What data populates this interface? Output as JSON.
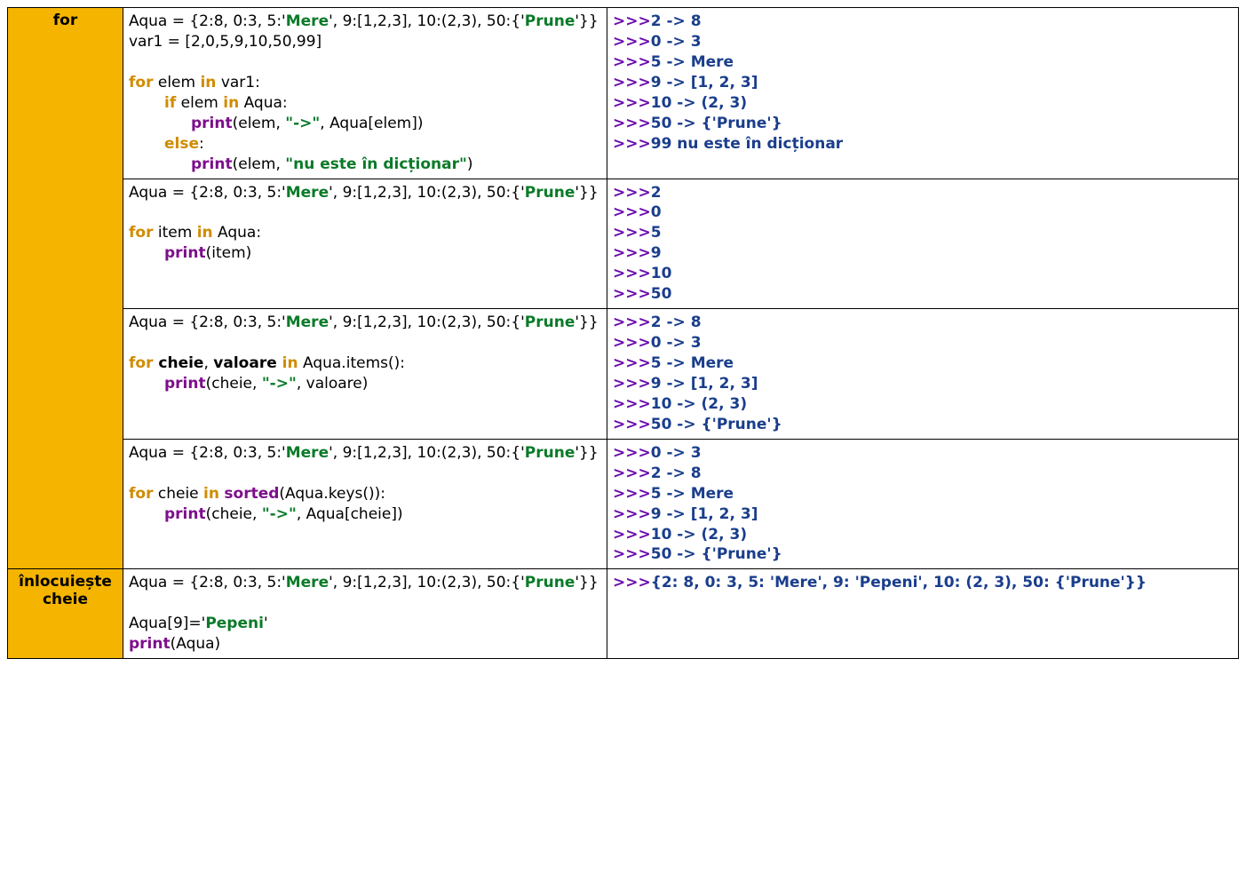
{
  "labels": {
    "for": "for",
    "replace": "înlocuiește cheie"
  },
  "common": {
    "aqua_prefix": "Aqua = {2:8, 0:3, 5:'",
    "aqua_mere": "Mere",
    "aqua_mid": "', 9:[1,2,3], 10:(2,3), 50:{'",
    "aqua_prune": "Prune",
    "aqua_suffix": "'}}"
  },
  "r1": {
    "var1": "var1 = [2,0,5,9,10,50,99]",
    "for": "for",
    "elem_in": " elem ",
    "in": "in",
    "var1b": " var1:",
    "if": "if",
    "cond": " elem ",
    "aqua": " Aqua:",
    "print": "print",
    "p1": "(elem, ",
    "arrow": "\"->\"",
    "p1b": ", Aqua[elem])",
    "else": "else",
    "p2": "(elem, ",
    "msg": "\"nu este în dicționar\"",
    "p2b": ")",
    "out": [
      "2 -> 8",
      "0 -> 3",
      "5 -> Mere",
      "9 -> [1, 2, 3]",
      "10 -> (2, 3)",
      "50 -> {'Prune'}",
      "99 nu este în dicționar"
    ]
  },
  "r2": {
    "for": "for",
    "item": " item ",
    "in": "in",
    "aqua": " Aqua:",
    "print": "print",
    "arg": "(item)",
    "out": [
      "2",
      "0",
      "5",
      "9",
      "10",
      "50"
    ]
  },
  "r3": {
    "for": "for",
    "cheie": " cheie",
    "comma": ", ",
    "valoare": "valoare ",
    "in": "in",
    "rest": " Aqua.items():",
    "print": "print",
    "arg1": "(cheie, ",
    "arrow": "\"->\"",
    "arg2": ", valoare)",
    "out": [
      "2 -> 8",
      "0 -> 3",
      "5 -> Mere",
      "9 -> [1, 2, 3]",
      "10 -> (2, 3)",
      "50 -> {'Prune'}"
    ]
  },
  "r4": {
    "for": "for",
    "cheie": " cheie ",
    "in": "in",
    "sorted": "sorted",
    "rest1": " ",
    "rest2": "(Aqua.keys()):",
    "print": "print",
    "arg1": "(cheie, ",
    "arrow": "\"->\"",
    "arg2": ", Aqua[cheie])",
    "out": [
      "0 -> 3",
      "2 -> 8",
      "5 -> Mere",
      "9 -> [1, 2, 3]",
      "10 -> (2, 3)",
      "50 -> {'Prune'}"
    ]
  },
  "r5": {
    "assign1": "Aqua[9]='",
    "pepeni": "Pepeni",
    "assign2": "'",
    "print": "print",
    "arg": "(Aqua)",
    "out": "{2: 8, 0: 3, 5: 'Mere', 9: 'Pepeni', 10: (2, 3), 50: {'Prune'}}"
  },
  "prompt": ">>>"
}
